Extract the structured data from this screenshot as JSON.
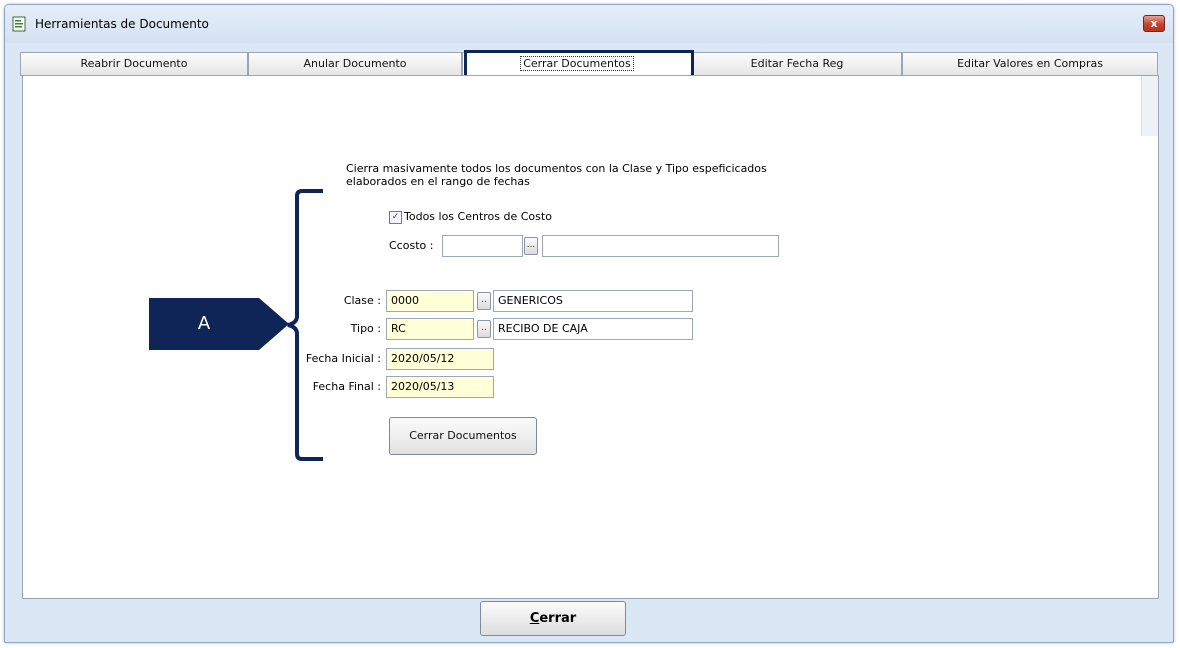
{
  "window": {
    "title": "Herramientas de Documento",
    "close_label": "x"
  },
  "tabs": [
    {
      "label": "Reabrir Documento"
    },
    {
      "label": "Anular Documento"
    },
    {
      "label": "Cerrar Documentos",
      "active": true
    },
    {
      "label": "Editar Fecha Reg"
    },
    {
      "label": "Editar Valores en Compras"
    }
  ],
  "form": {
    "description_line1": "Cierra masivamente todos los documentos con la Clase y Tipo espeficicados",
    "description_line2": "elaborados en el rango de fechas",
    "all_cost_centers_label": "Todos los Centros de Costo",
    "all_cost_centers_checked": true,
    "ccosto_label": "Ccosto :",
    "ccosto_code": "",
    "ccosto_name": "",
    "clase_label": "Clase :",
    "clase_code": "0000",
    "clase_name": "GENERICOS",
    "tipo_label": "Tipo :",
    "tipo_code": "RC",
    "tipo_name": "RECIBO DE CAJA",
    "fecha_inicial_label": "Fecha Inicial :",
    "fecha_inicial": "2020/05/12",
    "fecha_final_label": "Fecha Final :",
    "fecha_final": "2020/05/13",
    "lookup_label": "...",
    "lookup_small_label": "..",
    "submit_label": "Cerrar Documentos"
  },
  "annotation": {
    "callout_label": "A",
    "color": "#0f2558"
  },
  "footer": {
    "close_first_letter": "C",
    "close_rest": "errar"
  },
  "colors": {
    "input_highlight": "#ffffd8",
    "window_frame": "#dbe7f5"
  }
}
